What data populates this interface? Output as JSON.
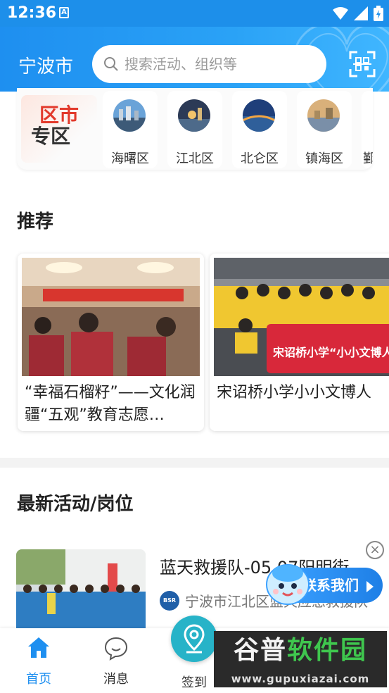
{
  "status_bar": {
    "time": "12:36",
    "sim_label": "A"
  },
  "header": {
    "city": "宁波市",
    "search_placeholder": "搜索活动、组织等"
  },
  "district": {
    "title_line1": "区市",
    "title_line2": "专区",
    "items": [
      {
        "label": "海曙区"
      },
      {
        "label": "江北区"
      },
      {
        "label": "北仑区"
      },
      {
        "label": "镇海区"
      },
      {
        "label": "鄞"
      }
    ]
  },
  "recommend": {
    "title": "推荐",
    "cards": [
      {
        "caption": "“幸福石榴籽”——文化润疆“五观”教育志愿…"
      },
      {
        "caption": "宋诏桥小学小小文博人"
      }
    ]
  },
  "latest": {
    "title": "最新活动/岗位",
    "item": {
      "title": "蓝天救援队-05.07阳明街",
      "org": "宁波市江北区蓝天应急救援队"
    }
  },
  "float": {
    "contact_label": "联系我们",
    "close_symbol": "×"
  },
  "bottom_nav": [
    {
      "label": "首页",
      "active": true
    },
    {
      "label": "消息",
      "active": false
    },
    {
      "label": "签到",
      "active": false
    }
  ],
  "watermark": {
    "line1_a": "谷普",
    "line1_b": "软件园",
    "line2": "www.gupuxiazai.com"
  },
  "colors": {
    "primary": "#1e8ff0",
    "accent_red": "#e23a2c",
    "checkin": "#27b3c8"
  }
}
